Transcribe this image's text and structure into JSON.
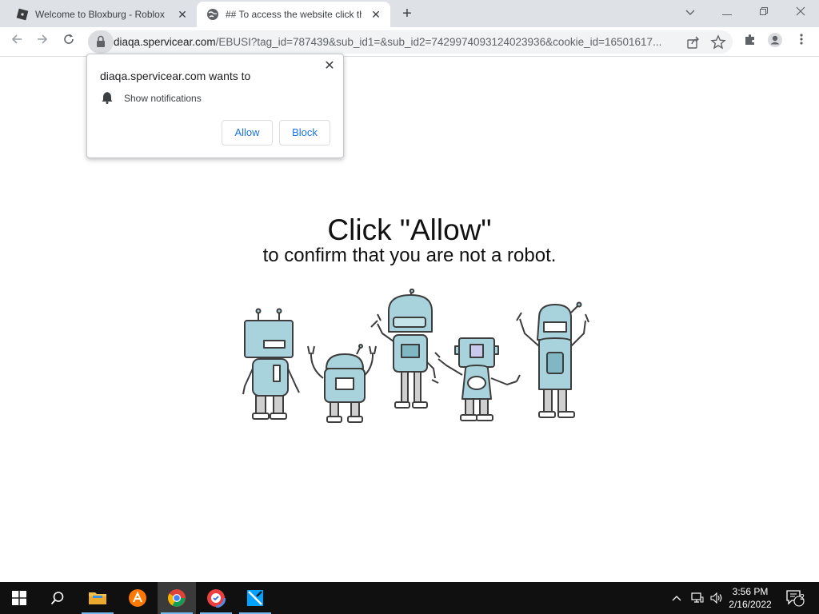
{
  "browser": {
    "tabs": [
      {
        "title": "Welcome to Bloxburg - Roblox",
        "active": false
      },
      {
        "title": "## To access the website click the",
        "active": true
      }
    ],
    "omnibox": {
      "host": "diaqa.spervicear.com",
      "path": "/EBUSI?tag_id=787439&sub_id1=&sub_id2=7429974093124023936&cookie_id=16501617..."
    }
  },
  "popup": {
    "title": "diaqa.spervicear.com wants to",
    "permission": "Show notifications",
    "allow_label": "Allow",
    "block_label": "Block"
  },
  "page": {
    "headline": "Click \"Allow\"",
    "subline": "to confirm that you are not a robot."
  },
  "taskbar": {
    "time": "3:56 PM",
    "date": "2/16/2022",
    "notification_count": "2"
  },
  "colors": {
    "accent": "#1a73e8",
    "robot_fill": "#a9d3dc",
    "robot_stroke": "#3d3d3d"
  }
}
